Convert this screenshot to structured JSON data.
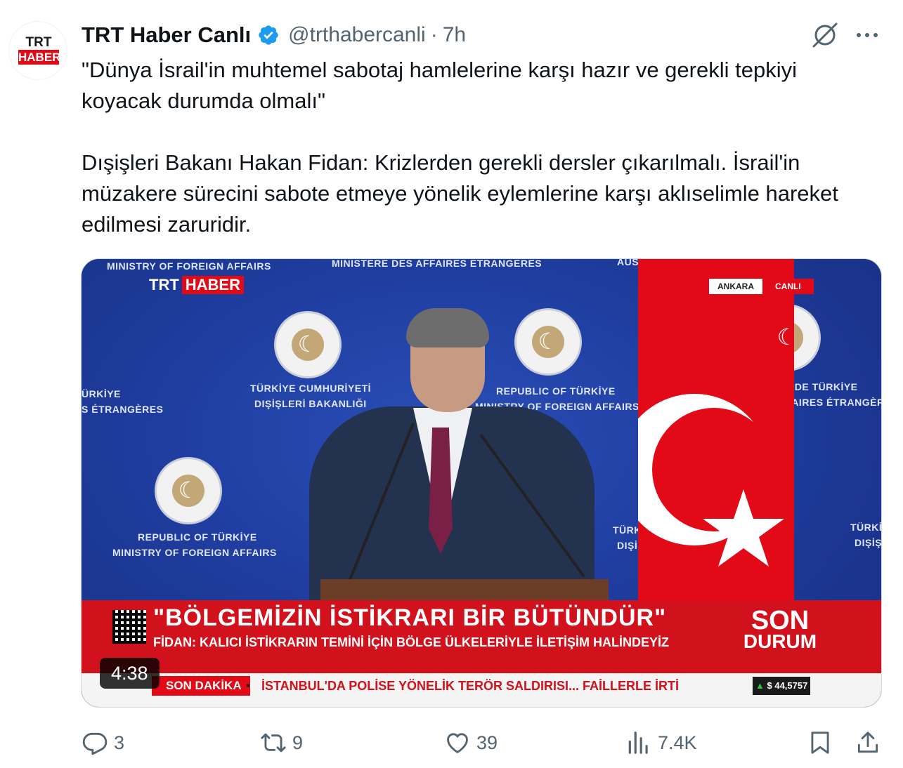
{
  "author": {
    "avatar_text_top": "TRT",
    "avatar_text_bottom": "HABER",
    "display_name": "TRT Haber Canlı",
    "handle": "@trthabercanli",
    "separator": "·",
    "time": "7h",
    "verified_color": "#1d9bf0"
  },
  "tweet": {
    "paragraph1": "\"Dünya İsrail'in muhtemel sabotaj hamlelerine karşı hazır ve gerekli tepkiyi koyacak durumda olmalı\"",
    "paragraph2": "Dışişleri Bakanı Hakan Fidan: Krizlerden gerekli dersler çıkarılmalı. İsrail'in müzakere sürecini sabote etmeye yönelik eylemlerine karşı aklıselimle hareket edilmesi zaruridir."
  },
  "video": {
    "wall": {
      "top_left": "MINISTRY OF FOREIGN AFFAIRS",
      "top_center": "MINISTERE DES AFFAIRES ETRANGERES",
      "top_right": "AUSSENMINIST",
      "left_1": "ÜRKİYE",
      "left_2": "S ÉTRANGÈRES",
      "center_1": "TÜRKİYE CUMHURİYETİ",
      "center_2": "DIŞİŞLERİ BAKANLIĞI",
      "mid_1": "REPUBLIC OF TÜRKİYE",
      "mid_2": "MINISTRY OF FOREIGN AFFAIRS",
      "right_1": "PUBLIQUE DE TÜRKİYE",
      "right_2": "E DES AFFAIRES ÉTRANGÈRES",
      "bottom_left_1": "REPUBLIC OF TÜRKİYE",
      "bottom_left_2": "MINISTRY OF FOREIGN AFFAIRS",
      "bottom_mid_1": "TÜRKİY",
      "bottom_mid_2": "DIŞİŞ",
      "bottom_right_1": "TÜRKİ",
      "bottom_right_2": "DIŞİŞ"
    },
    "channel_logo_1": "TRT",
    "channel_logo_2": "HABER",
    "location": "ANKARA",
    "live_label": "CANLI",
    "headline": "\"BÖLGEMİZİN İSTİKRARI BİR BÜTÜNDÜR\"",
    "subline": "FİDAN: KALICI İSTİKRARIN TEMİNİ İÇİN BÖLGE ÜLKELERİYLE İLETİŞİM HALİNDEYİZ",
    "son_durum_1": "SON",
    "son_durum_2": "DURUM",
    "ticker_label": "SON DAKİKA",
    "ticker_bullet": "▪",
    "ticker_text": "İSTANBUL'DA POLİSE YÖNELİK TERÖR SALDIRISI... FAİLLERLE İRTİ",
    "ticker_price_arrow": "▲",
    "ticker_price": "$ 44,5757",
    "duration": "4:38"
  },
  "actions": {
    "replies": "3",
    "reposts": "9",
    "likes": "39",
    "views": "7.4K"
  }
}
